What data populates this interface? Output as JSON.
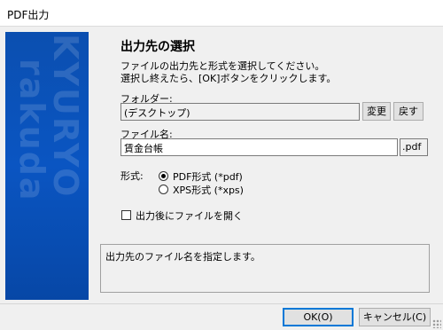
{
  "window": {
    "title": "PDF出力"
  },
  "banner": {
    "watermark_1": "KYURYO",
    "watermark_2": "rakuda"
  },
  "heading": "出力先の選択",
  "description": [
    "ファイルの出力先と形式を選択してください。",
    "選択し終えたら、[OK]ボタンをクリックします。"
  ],
  "folder": {
    "label": "フォルダー:",
    "value": "(デスクトップ)",
    "change_button": "変更",
    "reset_button": "戻す"
  },
  "filename": {
    "label": "ファイル名:",
    "value": "賃金台帳",
    "extension": ".pdf"
  },
  "format": {
    "label": "形式:",
    "options": [
      {
        "label": "PDF形式 (*pdf)",
        "selected": true
      },
      {
        "label": "XPS形式 (*xps)",
        "selected": false
      }
    ]
  },
  "open_after": {
    "label": "出力後にファイルを開く",
    "checked": false
  },
  "hint": "出力先のファイル名を指定します。",
  "buttons": {
    "ok": "OK(O)",
    "cancel": "キャンセル(C)"
  }
}
